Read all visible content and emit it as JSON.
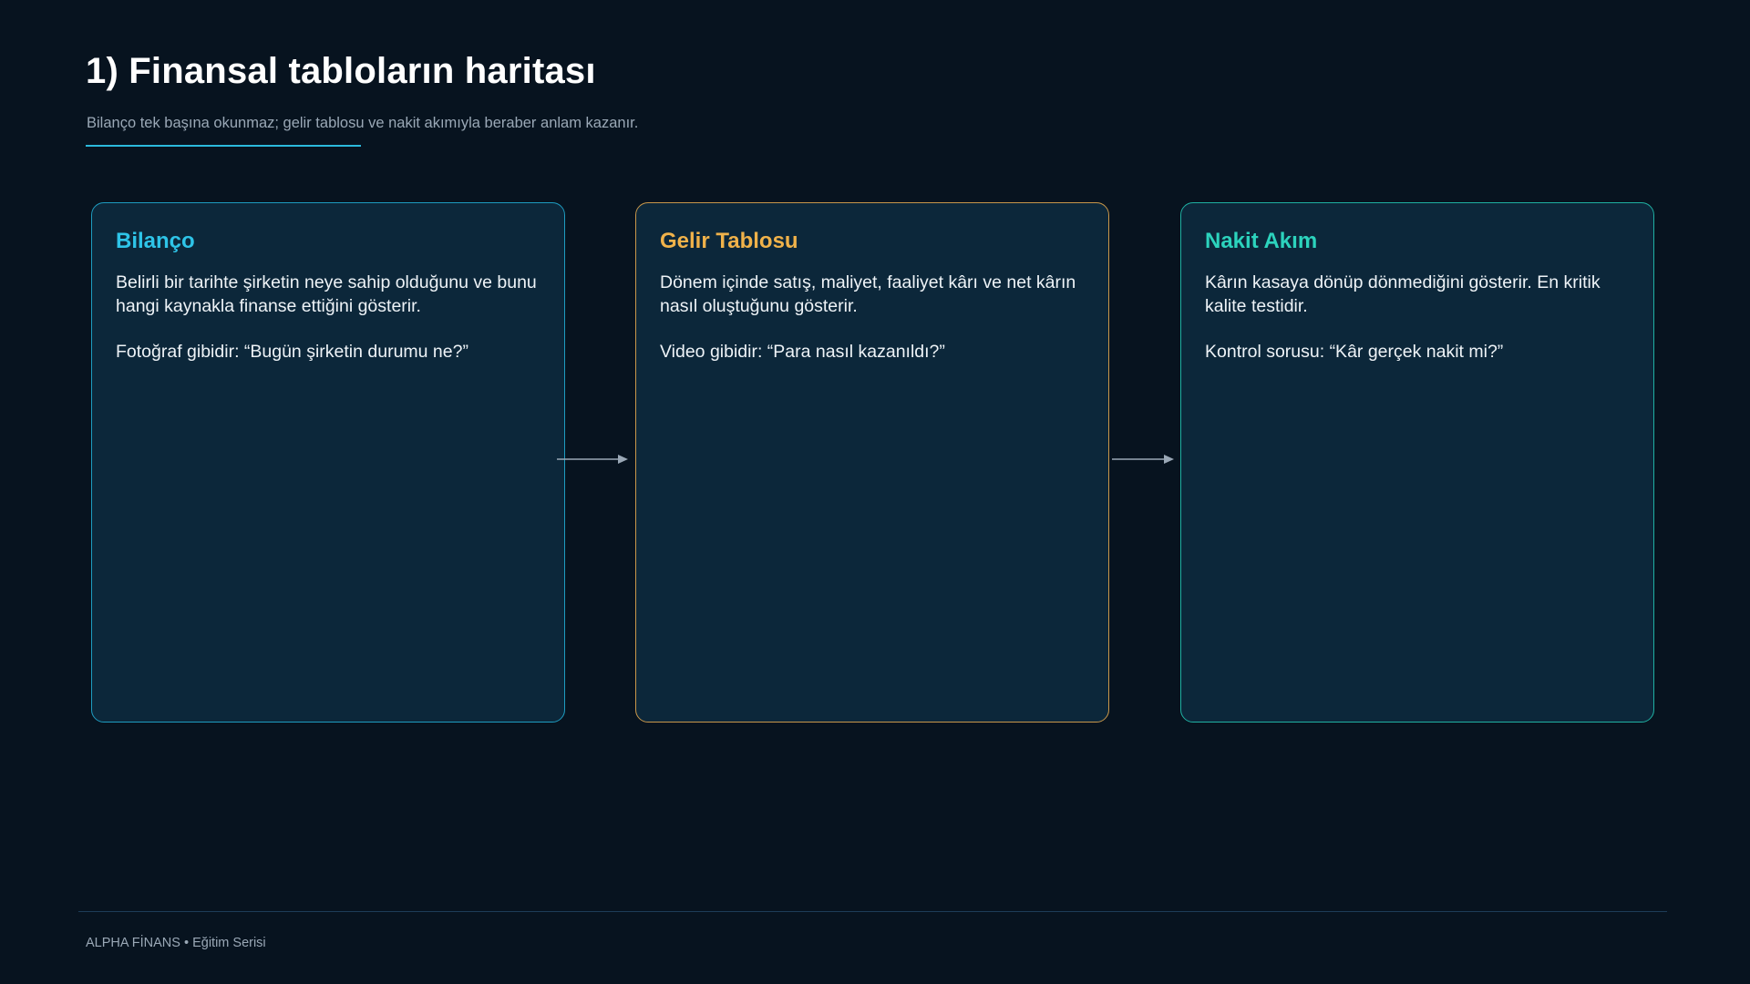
{
  "header": {
    "title": "1) Finansal tabloların haritası",
    "subtitle": "Bilanço tek başına okunmaz; gelir tablosu ve nakit akımıyla beraber anlam kazanır."
  },
  "cards": [
    {
      "title": "Bilanço",
      "description": "Belirli bir tarihte şirketin neye sahip olduğunu ve bunu hangi kaynakla finanse ettiğini gösterir.",
      "note": "Fotoğraf gibidir: “Bugün şirketin durumu ne?”"
    },
    {
      "title": "Gelir Tablosu",
      "description": "Dönem içinde satış, maliyet, faaliyet kârı ve net kârın nasıl oluştuğunu gösterir.",
      "note": "Video gibidir: “Para nasıl kazanıldı?”"
    },
    {
      "title": "Nakit Akım",
      "description": "Kârın kasaya dönüp dönmediğini gösterir. En kritik kalite testidir.",
      "note": "Kontrol sorusu: “Kâr gerçek nakit mi?”"
    }
  ],
  "footer": {
    "text": "ALPHA FİNANS • Eğitim Serisi"
  },
  "colors": {
    "background": "#07131f",
    "accent_blue": "#2ec4e8",
    "accent_gold": "#f0b24a",
    "accent_teal": "#2cd3bd",
    "card_bg": "#0c273a"
  }
}
